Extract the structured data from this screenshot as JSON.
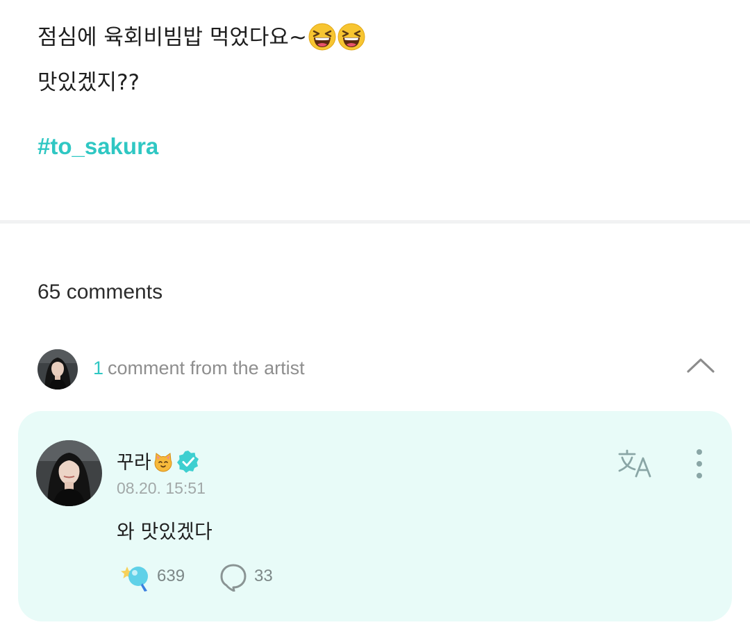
{
  "post": {
    "line1": "점심에 육회비빔밥 먹었다요~",
    "line1_emojis": [
      "laughing-face-emoji",
      "laughing-face-emoji"
    ],
    "line2": "맛있겠지??",
    "hashtag": "#to_sakura"
  },
  "comments": {
    "count_label": "65 comments",
    "artist_summary": {
      "count": "1",
      "label": "comment from the artist",
      "avatar": "artist-avatar",
      "toggle_icon": "chevron-up-icon"
    }
  },
  "artist_comment": {
    "author": "꾸라",
    "author_emoji": "cat-face-emoji",
    "verified_icon": "verified-badge-icon",
    "timestamp": "08.20. 15:51",
    "text": "와 맛있겠다",
    "likes": "639",
    "replies": "33",
    "actions": {
      "translate_icon": "translate-icon",
      "more_icon": "more-vertical-icon",
      "like_icon": "star-heart-icon",
      "reply_icon": "speech-bubble-icon"
    }
  },
  "colors": {
    "accent": "#2fc7c3",
    "card_background": "#e8fbf8",
    "muted_text": "#8e8e8e",
    "divider": "#f1f2f3"
  }
}
